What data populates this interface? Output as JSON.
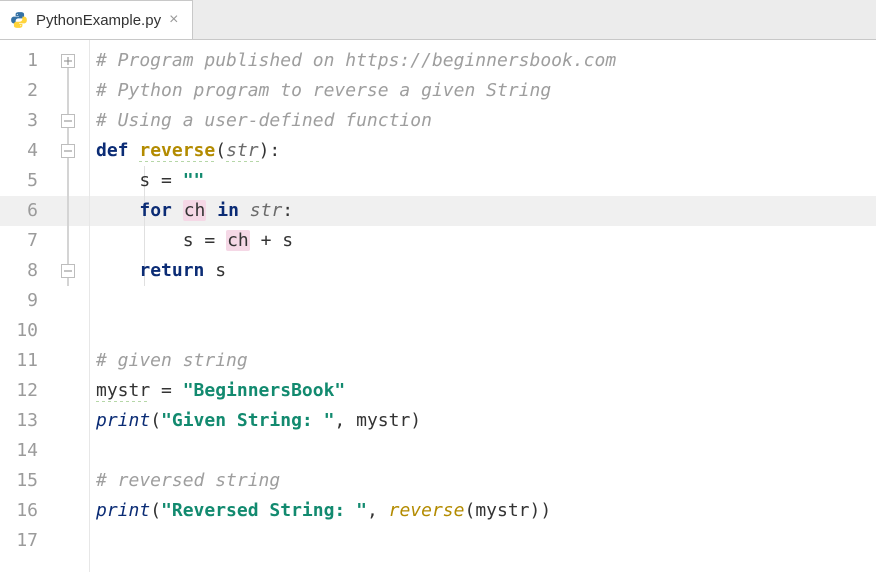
{
  "tab": {
    "filename": "PythonExample.py",
    "close_glyph": "×"
  },
  "editor": {
    "highlighted_line": 6,
    "line_count": 17,
    "lines": {
      "l1": {
        "comment": "# Program published on https://beginnersbook.com"
      },
      "l2": {
        "comment": "# Python program to reverse a given String"
      },
      "l3": {
        "comment": "# Using a user-defined function"
      },
      "l4": {
        "kw1": "def ",
        "fn": "reverse",
        "p_open": "(",
        "param": "str",
        "p_close": "):"
      },
      "l5": {
        "indent": "    ",
        "ident": "s",
        "eq": " = ",
        "str": "\"\""
      },
      "l6": {
        "indent": "    ",
        "kw1": "for ",
        "var": "ch",
        "kw2": " in ",
        "param": "str",
        "colon": ":"
      },
      "l7": {
        "indent": "        ",
        "ident1": "s",
        "eq": " = ",
        "var": "ch",
        "plus": " + ",
        "ident2": "s"
      },
      "l8": {
        "indent": "    ",
        "kw": "return ",
        "ident": "s"
      },
      "l11": {
        "comment": "# given string"
      },
      "l12": {
        "ident": "mystr",
        "eq": " = ",
        "str": "\"BeginnersBook\""
      },
      "l13": {
        "builtin": "print",
        "p_open": "(",
        "str": "\"Given String: \"",
        "comma": ", ",
        "ident": "mystr",
        "p_close": ")"
      },
      "l15": {
        "comment": "# reversed string"
      },
      "l16": {
        "builtin": "print",
        "p_open": "(",
        "str": "\"Reversed String: \"",
        "comma": ", ",
        "fn": "reverse",
        "p2": "(",
        "ident": "mystr",
        "p3": "))"
      }
    }
  }
}
